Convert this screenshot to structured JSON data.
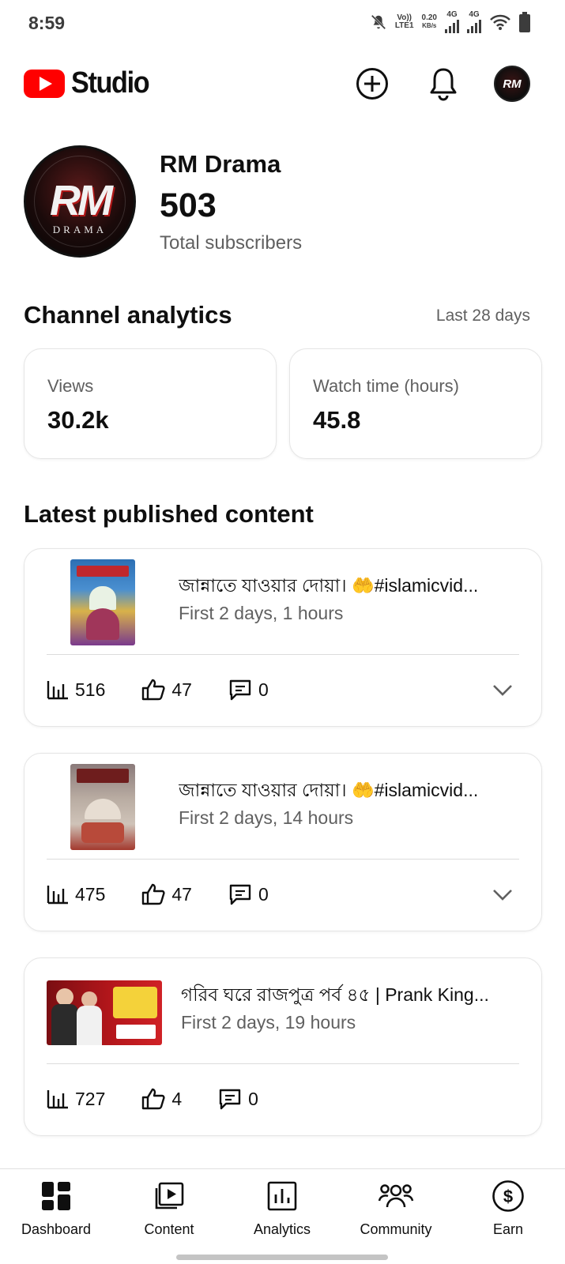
{
  "status_bar": {
    "time": "8:59",
    "volte": "Vo))",
    "lte": "LTE1",
    "speed_value": "0.20",
    "speed_unit": "KB/s",
    "net1": "4G",
    "net2": "4G"
  },
  "header": {
    "app_name": "Studio",
    "brand_color": "#ff0000",
    "avatar_text": "RM"
  },
  "channel": {
    "avatar_text": "RM",
    "avatar_subtext": "DRAMA",
    "name": "RM Drama",
    "subscribers": "503",
    "subscribers_label": "Total subscribers"
  },
  "analytics": {
    "title": "Channel analytics",
    "period": "Last 28 days",
    "cards": [
      {
        "label": "Views",
        "value": "30.2k"
      },
      {
        "label": "Watch time (hours)",
        "value": "45.8"
      }
    ]
  },
  "latest": {
    "title": "Latest published content",
    "items": [
      {
        "title": "জান্নাতে যাওয়ার দোয়া। 🤲#islamicvid...",
        "meta": "First 2 days, 1 hours",
        "views": "516",
        "likes": "47",
        "comments": "0",
        "thumb_type": "portrait",
        "thumb_colors": [
          "#2c6fb3",
          "#d8b24a",
          "#7a3a8c"
        ]
      },
      {
        "title": "জান্নাতে যাওয়ার দোয়া। 🤲#islamicvid...",
        "meta": "First 2 days, 14 hours",
        "views": "475",
        "likes": "47",
        "comments": "0",
        "thumb_type": "portrait",
        "thumb_colors": [
          "#8a7a7a",
          "#cfc3b8",
          "#a3392e"
        ]
      },
      {
        "title": "গরিব ঘরে রাজপুত্র পর্ব ৪৫ | Prank King...",
        "meta": "First 2 days, 19 hours",
        "views": "727",
        "likes": "4",
        "comments": "0",
        "thumb_type": "landscape",
        "thumb_colors": [
          "#b3161b",
          "#f4d23a",
          "#ffffff"
        ]
      }
    ]
  },
  "bottom_nav": {
    "items": [
      {
        "label": "Dashboard",
        "icon": "dashboard-icon"
      },
      {
        "label": "Content",
        "icon": "content-icon"
      },
      {
        "label": "Analytics",
        "icon": "analytics-icon"
      },
      {
        "label": "Community",
        "icon": "community-icon"
      },
      {
        "label": "Earn",
        "icon": "earn-icon"
      }
    ]
  }
}
